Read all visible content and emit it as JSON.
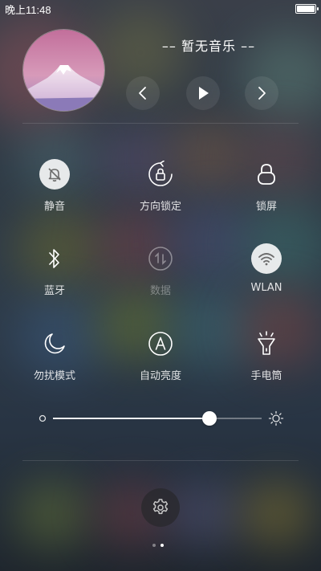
{
  "status_bar": {
    "time": "晚上11:48",
    "battery_level": 1.0
  },
  "music": {
    "title": "–– 暂无音乐 ––",
    "controls": {
      "prev_icon": "chevron-left-icon",
      "play_icon": "play-icon",
      "next_icon": "chevron-right-icon"
    }
  },
  "toggles": [
    {
      "label": "静音",
      "icon": "bell-off-icon",
      "on": true
    },
    {
      "label": "方向锁定",
      "icon": "rotation-lock-icon",
      "on": false
    },
    {
      "label": "锁屏",
      "icon": "lock-icon",
      "on": false
    },
    {
      "label": "蓝牙",
      "icon": "bluetooth-icon",
      "on": false
    },
    {
      "label": "数据",
      "icon": "data-icon",
      "on": false,
      "disabled": true
    },
    {
      "label": "WLAN",
      "icon": "wifi-icon",
      "on": true
    },
    {
      "label": "勿扰模式",
      "icon": "moon-icon",
      "on": false
    },
    {
      "label": "自动亮度",
      "icon": "auto-brightness-icon",
      "on": false
    },
    {
      "label": "手电筒",
      "icon": "flashlight-icon",
      "on": false
    }
  ],
  "brightness": {
    "level": 0.75,
    "min_icon": "brightness-low-icon",
    "max_icon": "brightness-high-icon"
  },
  "bottom": {
    "settings_icon": "gear-icon",
    "page_count": 2,
    "active_page": 2
  }
}
